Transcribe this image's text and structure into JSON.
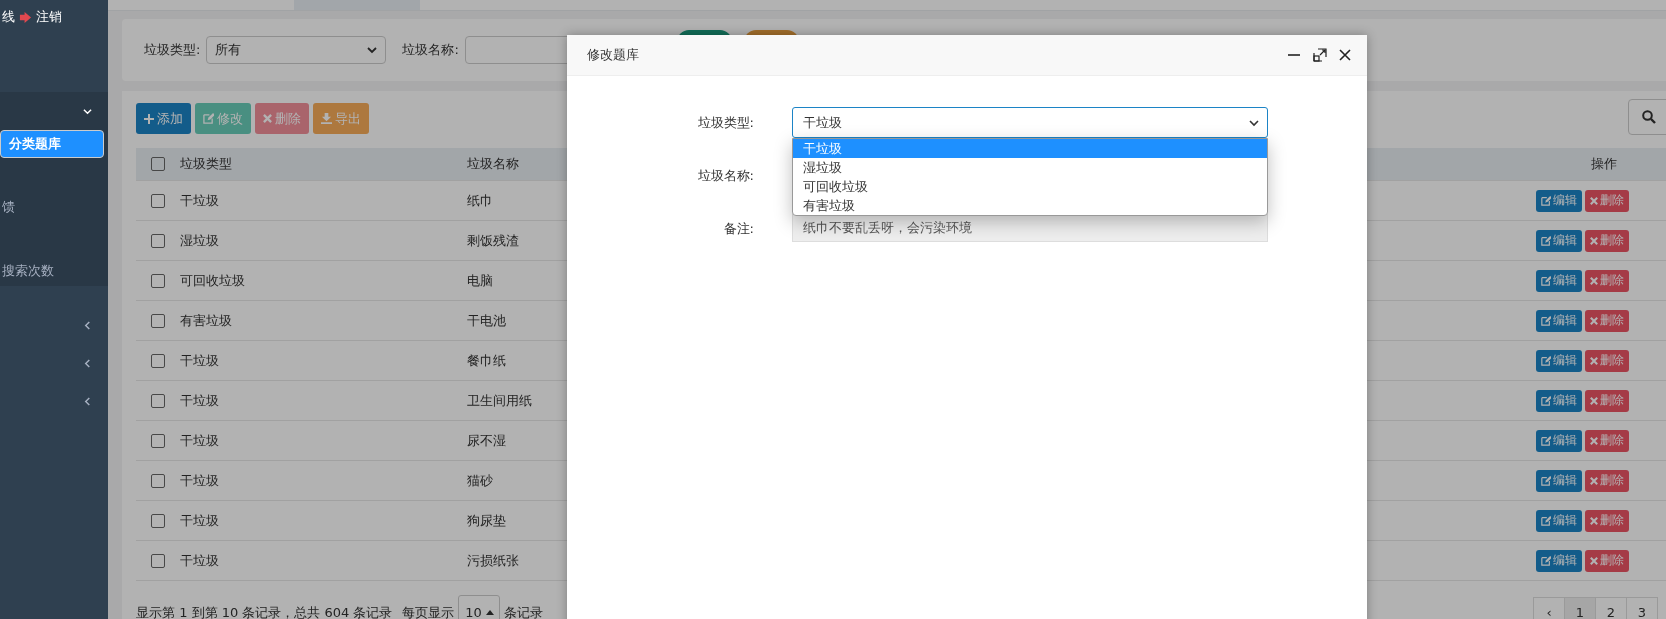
{
  "sidebar": {
    "status": "线",
    "logout": "注销",
    "items": [
      {
        "expanded": true,
        "children": [
          {
            "label": "分类题库",
            "selected": true
          },
          {
            "label": "馈",
            "selected": false
          },
          {
            "label": "搜索次数",
            "selected": false
          }
        ]
      },
      {
        "expanded": false
      },
      {
        "expanded": false
      },
      {
        "expanded": false
      }
    ]
  },
  "search": {
    "type_label": "垃圾类型:",
    "type_value": "所有",
    "name_label": "垃圾名称:"
  },
  "toolbar": [
    {
      "label": "添加",
      "kind": "add",
      "disabled": false
    },
    {
      "label": "修改",
      "kind": "edit",
      "disabled": true
    },
    {
      "label": "删除",
      "kind": "delete",
      "disabled": true
    },
    {
      "label": "导出",
      "kind": "export",
      "disabled": false
    }
  ],
  "table": {
    "all_checked": false,
    "columns": [
      "垃圾类型",
      "垃圾名称",
      "操作"
    ],
    "rows": [
      {
        "type": "干垃圾",
        "name": "纸巾",
        "checked": false,
        "edit": "编辑",
        "delete": "删除"
      },
      {
        "type": "湿垃圾",
        "name": "剩饭残渣",
        "checked": false,
        "edit": "编辑",
        "delete": "删除"
      },
      {
        "type": "可回收垃圾",
        "name": "电脑",
        "checked": false,
        "edit": "编辑",
        "delete": "删除"
      },
      {
        "type": "有害垃圾",
        "name": "干电池",
        "checked": false,
        "edit": "编辑",
        "delete": "删除"
      },
      {
        "type": "干垃圾",
        "name": "餐巾纸",
        "checked": false,
        "edit": "编辑",
        "delete": "删除"
      },
      {
        "type": "干垃圾",
        "name": "卫生间用纸",
        "checked": false,
        "edit": "编辑",
        "delete": "删除"
      },
      {
        "type": "干垃圾",
        "name": "尿不湿",
        "checked": false,
        "edit": "编辑",
        "delete": "删除"
      },
      {
        "type": "干垃圾",
        "name": "猫砂",
        "checked": false,
        "edit": "编辑",
        "delete": "删除"
      },
      {
        "type": "干垃圾",
        "name": "狗尿垫",
        "checked": false,
        "edit": "编辑",
        "delete": "删除"
      },
      {
        "type": "干垃圾",
        "name": "污损纸张",
        "checked": false,
        "edit": "编辑",
        "delete": "删除"
      }
    ]
  },
  "footer": {
    "summary": "显示第 1 到第 10 条记录，总共 604 条记录",
    "per_page_before": "每页显示",
    "per_page": "10",
    "per_page_after": "条记录",
    "pages": [
      {
        "label": "‹",
        "selected": false
      },
      {
        "label": "1",
        "selected": true
      },
      {
        "label": "2",
        "selected": false
      },
      {
        "label": "3",
        "selected": false
      }
    ]
  },
  "dialog": {
    "title": "修改题库",
    "fields": [
      {
        "label": "垃圾类型:",
        "kind": "select",
        "value": "干垃圾",
        "options": [
          {
            "label": "干垃圾",
            "selected": true
          },
          {
            "label": "湿垃圾",
            "selected": false
          },
          {
            "label": "可回收垃圾",
            "selected": false
          },
          {
            "label": "有害垃圾",
            "selected": false
          }
        ]
      },
      {
        "label": "垃圾名称:",
        "kind": "text"
      },
      {
        "label": "备注:",
        "kind": "readonly",
        "value": "纸巾不要乱丢呀，会污染环境"
      }
    ]
  }
}
